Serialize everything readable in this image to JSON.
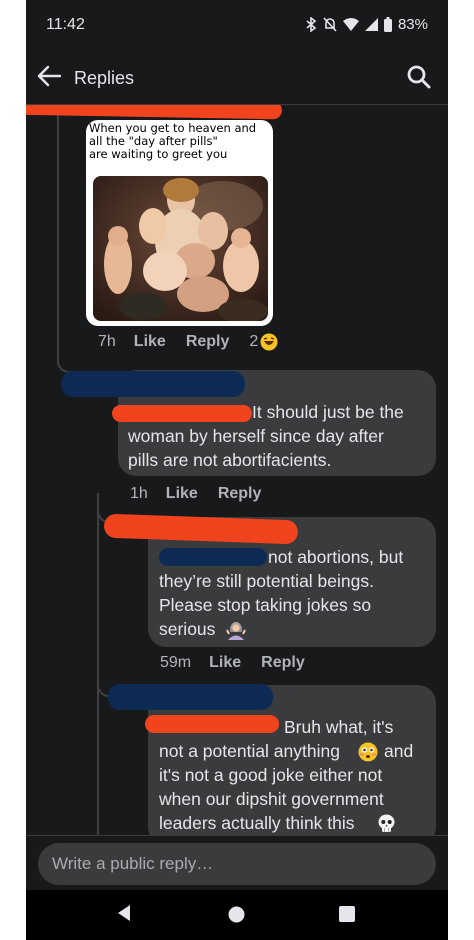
{
  "status_bar": {
    "time": "11:42",
    "battery": "83%",
    "icons": [
      "bluetooth-icon",
      "mute-icon",
      "wifi-icon",
      "signal-icon",
      "battery-icon"
    ]
  },
  "header": {
    "title": "Replies",
    "back_icon": "arrow-left-icon",
    "search_icon": "search-icon"
  },
  "meme": {
    "caption": "When you get to heaven and\nall the \"day after pills\"\nare waiting to greet you",
    "image": "painting of woman surrounded by cherubs"
  },
  "comments": [
    {
      "actions": {
        "time": "7h",
        "like": "Like",
        "reply": "Reply",
        "reaction_count": "2",
        "reaction_icon": "laughing-emoji-icon"
      }
    },
    {
      "lines": [
        "It should just be the",
        "woman by herself since day after",
        "pills are not abortifacients."
      ],
      "actions": {
        "time": "1h",
        "like": "Like",
        "reply": "Reply"
      }
    },
    {
      "lines": [
        "not abortions, but",
        "they’re still potential beings.",
        "Please stop taking jokes so",
        "serious"
      ],
      "emoji": "woman-shrugging-emoji-icon",
      "actions": {
        "time": "59m",
        "like": "Like",
        "reply": "Reply"
      }
    },
    {
      "lines": [
        "Bruh what, it's",
        "not a potential anything",
        "and",
        "it's not a good joke either not",
        "when our dipshit government",
        "leaders actually think this"
      ],
      "emojis": [
        "flushed-face-emoji-icon",
        "skull-emoji-icon"
      ]
    }
  ],
  "reply_bar": {
    "placeholder": "Write a public reply…"
  },
  "nav_bar": {
    "icons": [
      "back-triangle-icon",
      "home-circle-icon",
      "recents-square-icon"
    ]
  },
  "colors": {
    "background": "#18191a",
    "bubble": "#3a3b3c",
    "text": "#e4e6eb",
    "secondary_text": "#b0b3b8",
    "redaction_red": "#f0431e",
    "redaction_blue": "#0d2a55"
  }
}
